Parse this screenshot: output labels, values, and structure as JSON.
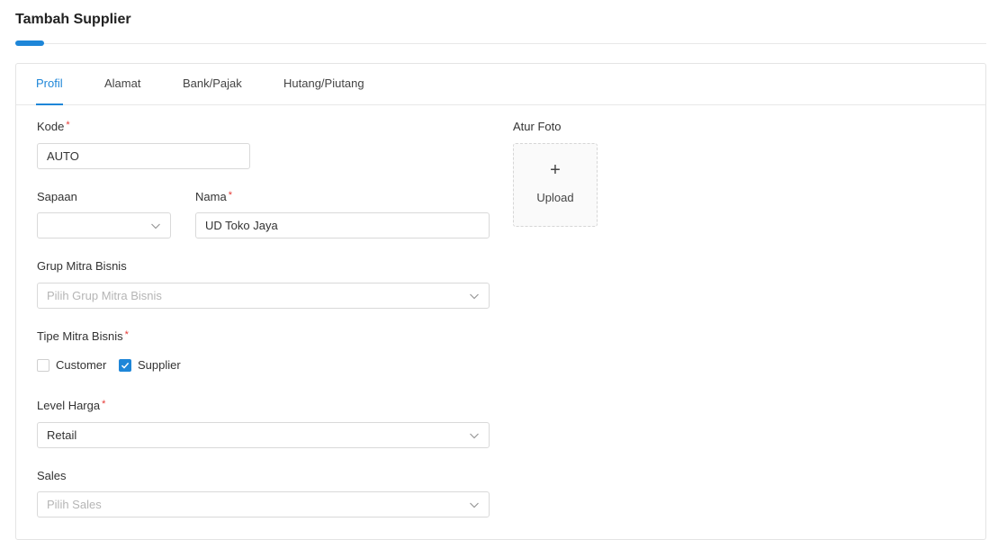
{
  "page": {
    "title": "Tambah Supplier"
  },
  "tabs": [
    {
      "label": "Profil",
      "active": true
    },
    {
      "label": "Alamat",
      "active": false
    },
    {
      "label": "Bank/Pajak",
      "active": false
    },
    {
      "label": "Hutang/Piutang",
      "active": false
    }
  ],
  "form": {
    "kode": {
      "label": "Kode",
      "required_mark": "*",
      "value": "AUTO"
    },
    "sapaan": {
      "label": "Sapaan",
      "value": ""
    },
    "nama": {
      "label": "Nama",
      "required_mark": "*",
      "value": "UD Toko Jaya"
    },
    "grup": {
      "label": "Grup Mitra Bisnis",
      "placeholder": "Pilih Grup Mitra Bisnis"
    },
    "tipe": {
      "label": "Tipe Mitra Bisnis",
      "required_mark": "*",
      "options": [
        {
          "label": "Customer",
          "checked": false
        },
        {
          "label": "Supplier",
          "checked": true
        }
      ]
    },
    "level": {
      "label": "Level Harga",
      "required_mark": "*",
      "value": "Retail"
    },
    "sales": {
      "label": "Sales",
      "placeholder": "Pilih Sales"
    }
  },
  "photo": {
    "label": "Atur Foto",
    "plus": "+",
    "upload_label": "Upload"
  },
  "colors": {
    "accent": "#1e86d8",
    "required": "#e53935"
  },
  "icons": {
    "dropdown": "chevron-down-icon",
    "check": "check-icon",
    "upload": "plus-icon"
  }
}
